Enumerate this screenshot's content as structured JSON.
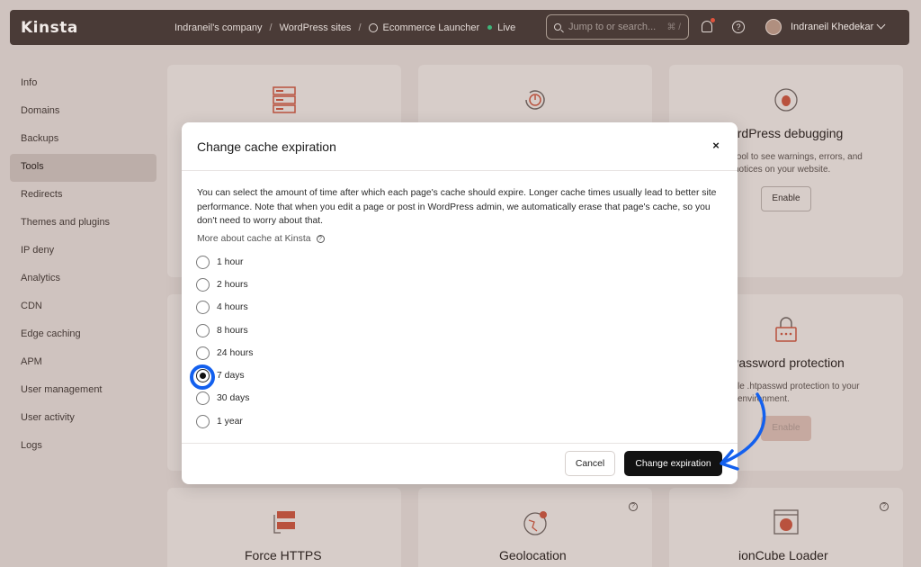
{
  "topbar": {
    "logo": "Kinsta",
    "breadcrumbs": [
      "Indraneil's company",
      "WordPress sites",
      "Ecommerce Launcher"
    ],
    "site_status": "Live",
    "search_placeholder": "Jump to or search...",
    "search_shortcut": "⌘ /",
    "user_name": "Indraneil Khedekar"
  },
  "sidebar": {
    "items": [
      "Info",
      "Domains",
      "Backups",
      "Tools",
      "Redirects",
      "Themes and plugins",
      "IP deny",
      "Analytics",
      "CDN",
      "Edge caching",
      "APM",
      "User management",
      "User activity",
      "Logs"
    ],
    "active": "Tools"
  },
  "cards": {
    "debugging_title": "WordPress debugging",
    "debugging_text": "tool to see warnings, errors, and notices on your website.",
    "debugging_button": "Enable",
    "password_title": "Password protection",
    "password_text": "le .htpasswd protection to your environment.",
    "password_button": "Enable",
    "https_title": "Force HTTPS",
    "geo_title": "Geolocation",
    "ioncube_title": "ionCube Loader"
  },
  "modal": {
    "title": "Change cache expiration",
    "close": "×",
    "description": "You can select the amount of time after which each page's cache should expire. Longer cache times usually lead to better site performance. Note that when you edit a page or post in WordPress admin, we automatically erase that page's cache, so you don't need to worry about that.",
    "more_link": "More about cache at Kinsta",
    "options": [
      "1 hour",
      "2 hours",
      "4 hours",
      "8 hours",
      "24 hours",
      "7 days",
      "30 days",
      "1 year"
    ],
    "selected": "7 days",
    "cancel_label": "Cancel",
    "confirm_label": "Change expiration"
  },
  "colors": {
    "accent_orange": "#e0533d",
    "highlight_blue": "#1360ee",
    "primary_button": "#121212"
  }
}
